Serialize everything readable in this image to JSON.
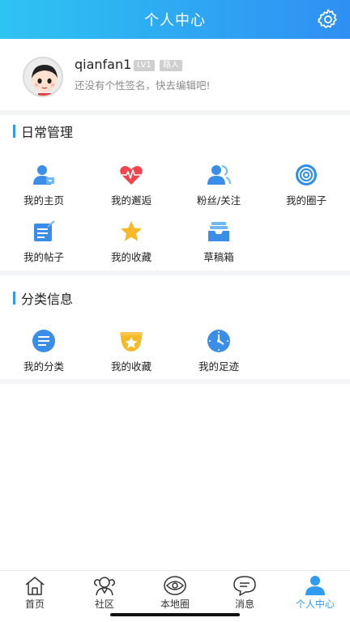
{
  "header": {
    "title": "个人中心",
    "settings_icon": "gear-icon"
  },
  "profile": {
    "username": "qianfan1",
    "level_badge": "LV1",
    "role_badge": "路人",
    "signature": "还没有个性签名，快去编辑吧!"
  },
  "daily": {
    "title": "日常管理",
    "items": [
      {
        "label": "我的主页",
        "icon": "user-home-icon"
      },
      {
        "label": "我的邂逅",
        "icon": "heart-pulse-icon"
      },
      {
        "label": "粉丝/关注",
        "icon": "followers-icon"
      },
      {
        "label": "我的圈子",
        "icon": "circle-target-icon"
      },
      {
        "label": "我的帖子",
        "icon": "post-edit-icon"
      },
      {
        "label": "我的收藏",
        "icon": "star-icon"
      },
      {
        "label": "草稿箱",
        "icon": "drafts-tray-icon"
      }
    ]
  },
  "category": {
    "title": "分类信息",
    "items": [
      {
        "label": "我的分类",
        "icon": "category-list-icon"
      },
      {
        "label": "我的收藏",
        "icon": "star-bowl-icon"
      },
      {
        "label": "我的足迹",
        "icon": "clock-icon"
      }
    ]
  },
  "tabbar": {
    "tabs": [
      {
        "label": "首页",
        "icon": "home-icon"
      },
      {
        "label": "社区",
        "icon": "community-icon"
      },
      {
        "label": "本地圈",
        "icon": "local-eye-icon"
      },
      {
        "label": "消息",
        "icon": "message-icon"
      },
      {
        "label": "个人中心",
        "icon": "profile-icon",
        "active": true
      }
    ]
  },
  "colors": {
    "accent": "#2f9bf3",
    "header_start": "#2ec4f2",
    "header_end": "#2f8ff3"
  }
}
